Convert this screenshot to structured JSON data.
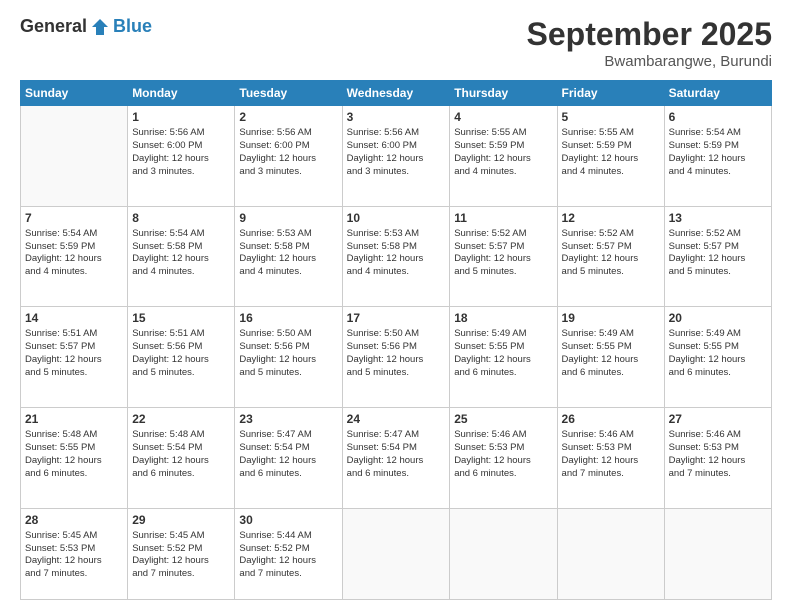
{
  "logo": {
    "general": "General",
    "blue": "Blue"
  },
  "header": {
    "month": "September 2025",
    "location": "Bwambarangwe, Burundi"
  },
  "days": [
    "Sunday",
    "Monday",
    "Tuesday",
    "Wednesday",
    "Thursday",
    "Friday",
    "Saturday"
  ],
  "weeks": [
    [
      {
        "day": "",
        "data": ""
      },
      {
        "day": "1",
        "data": "Sunrise: 5:56 AM\nSunset: 6:00 PM\nDaylight: 12 hours\nand 3 minutes."
      },
      {
        "day": "2",
        "data": "Sunrise: 5:56 AM\nSunset: 6:00 PM\nDaylight: 12 hours\nand 3 minutes."
      },
      {
        "day": "3",
        "data": "Sunrise: 5:56 AM\nSunset: 6:00 PM\nDaylight: 12 hours\nand 3 minutes."
      },
      {
        "day": "4",
        "data": "Sunrise: 5:55 AM\nSunset: 5:59 PM\nDaylight: 12 hours\nand 4 minutes."
      },
      {
        "day": "5",
        "data": "Sunrise: 5:55 AM\nSunset: 5:59 PM\nDaylight: 12 hours\nand 4 minutes."
      },
      {
        "day": "6",
        "data": "Sunrise: 5:54 AM\nSunset: 5:59 PM\nDaylight: 12 hours\nand 4 minutes."
      }
    ],
    [
      {
        "day": "7",
        "data": "Sunrise: 5:54 AM\nSunset: 5:59 PM\nDaylight: 12 hours\nand 4 minutes."
      },
      {
        "day": "8",
        "data": "Sunrise: 5:54 AM\nSunset: 5:58 PM\nDaylight: 12 hours\nand 4 minutes."
      },
      {
        "day": "9",
        "data": "Sunrise: 5:53 AM\nSunset: 5:58 PM\nDaylight: 12 hours\nand 4 minutes."
      },
      {
        "day": "10",
        "data": "Sunrise: 5:53 AM\nSunset: 5:58 PM\nDaylight: 12 hours\nand 4 minutes."
      },
      {
        "day": "11",
        "data": "Sunrise: 5:52 AM\nSunset: 5:57 PM\nDaylight: 12 hours\nand 5 minutes."
      },
      {
        "day": "12",
        "data": "Sunrise: 5:52 AM\nSunset: 5:57 PM\nDaylight: 12 hours\nand 5 minutes."
      },
      {
        "day": "13",
        "data": "Sunrise: 5:52 AM\nSunset: 5:57 PM\nDaylight: 12 hours\nand 5 minutes."
      }
    ],
    [
      {
        "day": "14",
        "data": "Sunrise: 5:51 AM\nSunset: 5:57 PM\nDaylight: 12 hours\nand 5 minutes."
      },
      {
        "day": "15",
        "data": "Sunrise: 5:51 AM\nSunset: 5:56 PM\nDaylight: 12 hours\nand 5 minutes."
      },
      {
        "day": "16",
        "data": "Sunrise: 5:50 AM\nSunset: 5:56 PM\nDaylight: 12 hours\nand 5 minutes."
      },
      {
        "day": "17",
        "data": "Sunrise: 5:50 AM\nSunset: 5:56 PM\nDaylight: 12 hours\nand 5 minutes."
      },
      {
        "day": "18",
        "data": "Sunrise: 5:49 AM\nSunset: 5:55 PM\nDaylight: 12 hours\nand 6 minutes."
      },
      {
        "day": "19",
        "data": "Sunrise: 5:49 AM\nSunset: 5:55 PM\nDaylight: 12 hours\nand 6 minutes."
      },
      {
        "day": "20",
        "data": "Sunrise: 5:49 AM\nSunset: 5:55 PM\nDaylight: 12 hours\nand 6 minutes."
      }
    ],
    [
      {
        "day": "21",
        "data": "Sunrise: 5:48 AM\nSunset: 5:55 PM\nDaylight: 12 hours\nand 6 minutes."
      },
      {
        "day": "22",
        "data": "Sunrise: 5:48 AM\nSunset: 5:54 PM\nDaylight: 12 hours\nand 6 minutes."
      },
      {
        "day": "23",
        "data": "Sunrise: 5:47 AM\nSunset: 5:54 PM\nDaylight: 12 hours\nand 6 minutes."
      },
      {
        "day": "24",
        "data": "Sunrise: 5:47 AM\nSunset: 5:54 PM\nDaylight: 12 hours\nand 6 minutes."
      },
      {
        "day": "25",
        "data": "Sunrise: 5:46 AM\nSunset: 5:53 PM\nDaylight: 12 hours\nand 6 minutes."
      },
      {
        "day": "26",
        "data": "Sunrise: 5:46 AM\nSunset: 5:53 PM\nDaylight: 12 hours\nand 7 minutes."
      },
      {
        "day": "27",
        "data": "Sunrise: 5:46 AM\nSunset: 5:53 PM\nDaylight: 12 hours\nand 7 minutes."
      }
    ],
    [
      {
        "day": "28",
        "data": "Sunrise: 5:45 AM\nSunset: 5:53 PM\nDaylight: 12 hours\nand 7 minutes."
      },
      {
        "day": "29",
        "data": "Sunrise: 5:45 AM\nSunset: 5:52 PM\nDaylight: 12 hours\nand 7 minutes."
      },
      {
        "day": "30",
        "data": "Sunrise: 5:44 AM\nSunset: 5:52 PM\nDaylight: 12 hours\nand 7 minutes."
      },
      {
        "day": "",
        "data": ""
      },
      {
        "day": "",
        "data": ""
      },
      {
        "day": "",
        "data": ""
      },
      {
        "day": "",
        "data": ""
      }
    ]
  ]
}
